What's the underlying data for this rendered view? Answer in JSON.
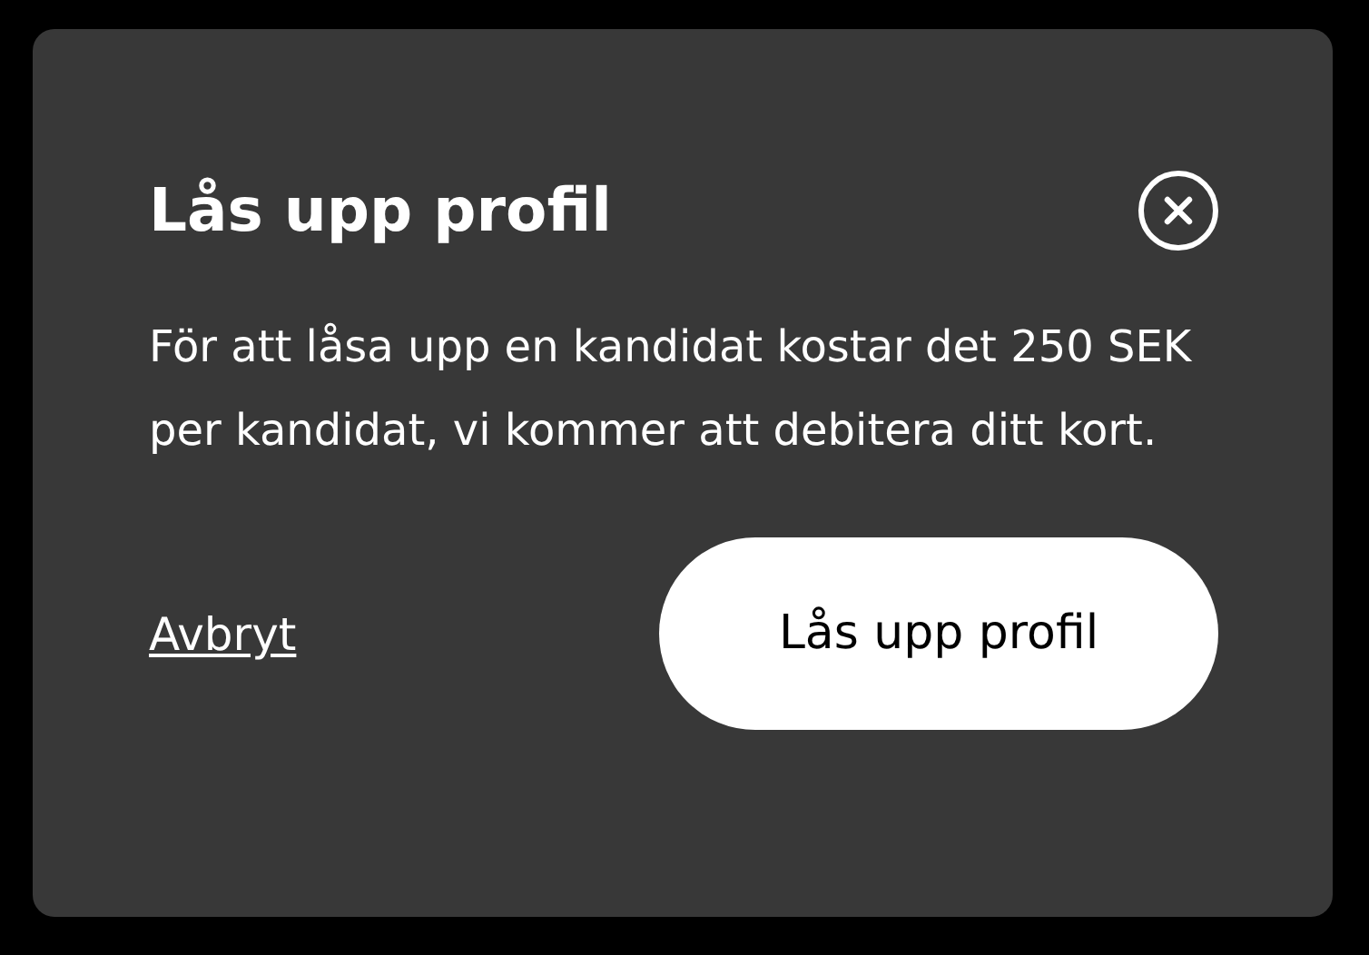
{
  "dialog": {
    "title": "Lås upp profil",
    "body": "För att låsa upp en kandidat kostar det 250 SEK per kandidat, vi kommer att debitera ditt kort.",
    "cancel_link": "Avbryt",
    "confirm_button": "Lås upp profil"
  }
}
